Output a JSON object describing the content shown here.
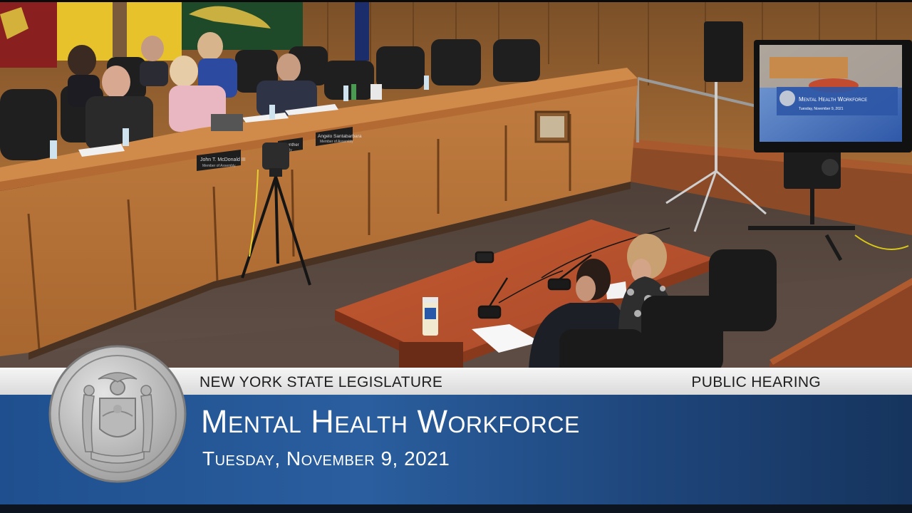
{
  "banner": {
    "organization": "NEW YORK STATE LEGISLATURE",
    "event_type": "PUBLIC HEARING",
    "title": "Mental Health Workforce",
    "date": "Tuesday, November 9, 2021"
  },
  "nameplates": [
    {
      "name": "John T. McDonald III",
      "role": "Member of Assembly"
    },
    {
      "name": "Angelo Santabarbara",
      "role": "Member of Assembly"
    },
    {
      "name": "...Gunther",
      "role": "...mbly"
    }
  ],
  "monitor": {
    "title": "Mental Health Workforce",
    "date": "Tuesday, November 9, 2021"
  },
  "colors": {
    "band_blue": "#1f4f8e",
    "strip_gray": "#e6e6e6",
    "wood_panel": "#b8773f",
    "witness_table": "#b4532e",
    "carpet": "#5a4a40"
  }
}
